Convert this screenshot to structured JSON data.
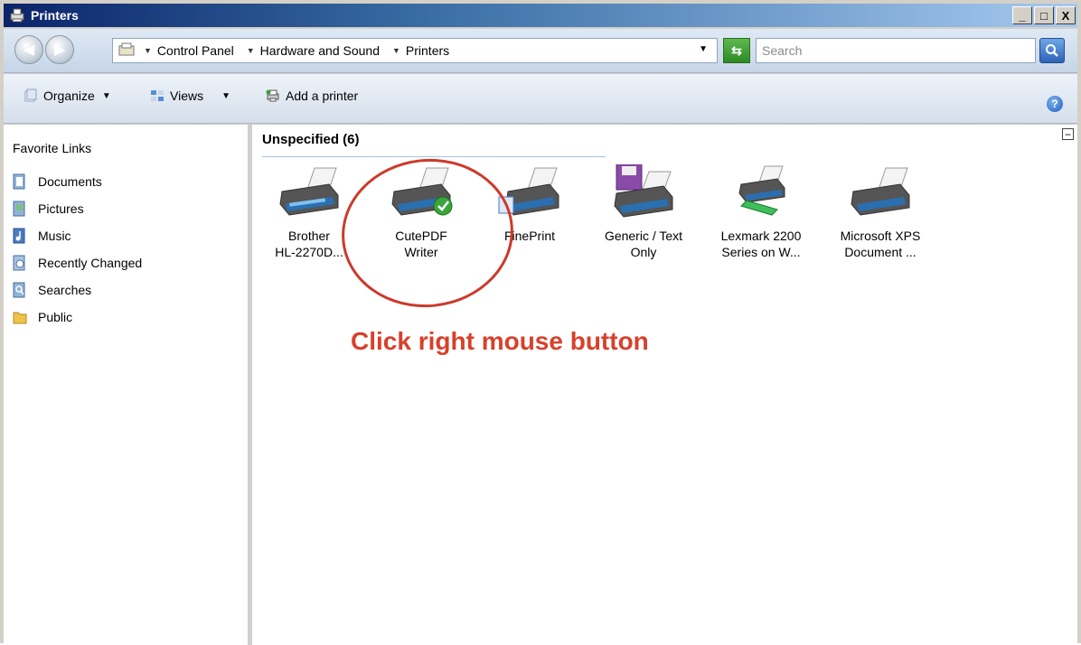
{
  "window": {
    "title": "Printers",
    "buttons": [
      "_",
      "□",
      "X"
    ]
  },
  "address": {
    "crumbs": [
      "Control Panel",
      "Hardware and Sound",
      "Printers"
    ],
    "search_placeholder": "Search"
  },
  "toolbar": {
    "organize": "Organize",
    "views": "Views",
    "add_printer": "Add a printer"
  },
  "sidebar": {
    "title": "Favorite Links",
    "items": [
      {
        "label": "Documents",
        "icon": "documents-icon"
      },
      {
        "label": "Pictures",
        "icon": "pictures-icon"
      },
      {
        "label": "Music",
        "icon": "music-icon"
      },
      {
        "label": "Recently Changed",
        "icon": "recently-changed-icon"
      },
      {
        "label": "Searches",
        "icon": "searches-icon"
      },
      {
        "label": "Public",
        "icon": "public-folder-icon"
      }
    ]
  },
  "group": {
    "header": "Unspecified (6)"
  },
  "printers": [
    {
      "line1": "Brother",
      "line2": "HL-2270D..."
    },
    {
      "line1": "CutePDF",
      "line2": "Writer"
    },
    {
      "line1": "FinePrint",
      "line2": ""
    },
    {
      "line1": "Generic / Text",
      "line2": "Only"
    },
    {
      "line1": "Lexmark 2200",
      "line2": "Series on W..."
    },
    {
      "line1": "Microsoft XPS",
      "line2": "Document ..."
    }
  ],
  "annotation": "Click right mouse button",
  "colors": {
    "annotation": "#d8402b",
    "title_bar": "#0a246a"
  }
}
